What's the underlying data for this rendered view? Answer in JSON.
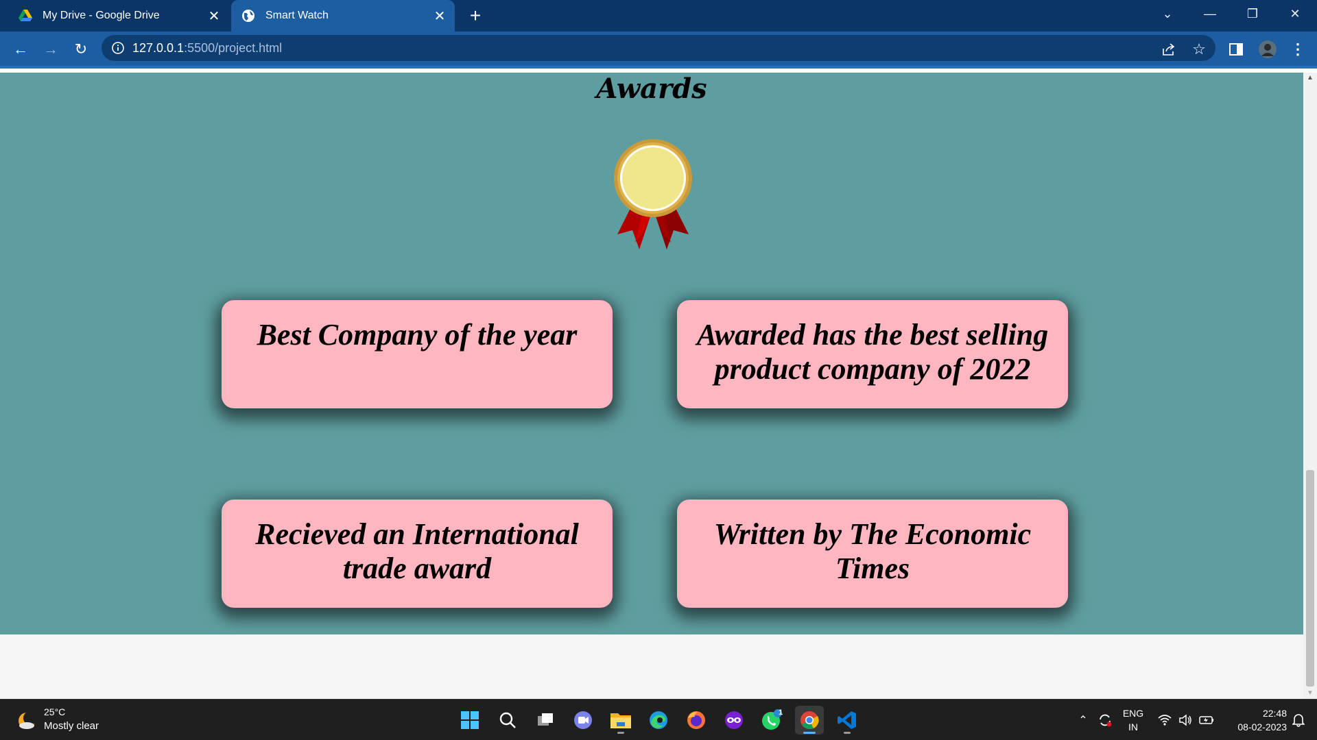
{
  "browser": {
    "tabs": [
      {
        "title": "My Drive - Google Drive",
        "icon": "google-drive-icon",
        "active": false
      },
      {
        "title": "Smart Watch",
        "icon": "globe-icon",
        "active": true
      }
    ],
    "url_host": "127.0.0.1",
    "url_rest": ":5500/project.html"
  },
  "page": {
    "title": "Awards",
    "cards": [
      {
        "text": "Best Company of the year"
      },
      {
        "text": "Awarded has the best selling product company of 2022"
      },
      {
        "text": "Recieved an International trade award"
      },
      {
        "text": "Written by The Economic Times"
      }
    ]
  },
  "taskbar": {
    "weather_temp": "25°C",
    "weather_desc": "Mostly clear",
    "lang_line1": "ENG",
    "lang_line2": "IN",
    "time": "22:48",
    "date": "08-02-2023",
    "whatsapp_badge": "1"
  },
  "colors": {
    "tabbar": "#0b3566",
    "toolbar": "#1d5ea3",
    "section_bg": "#5f9ea0",
    "card_bg": "#ffb6c1",
    "medal_gold": "#f0e68c",
    "ribbon_red": "#b30000"
  }
}
